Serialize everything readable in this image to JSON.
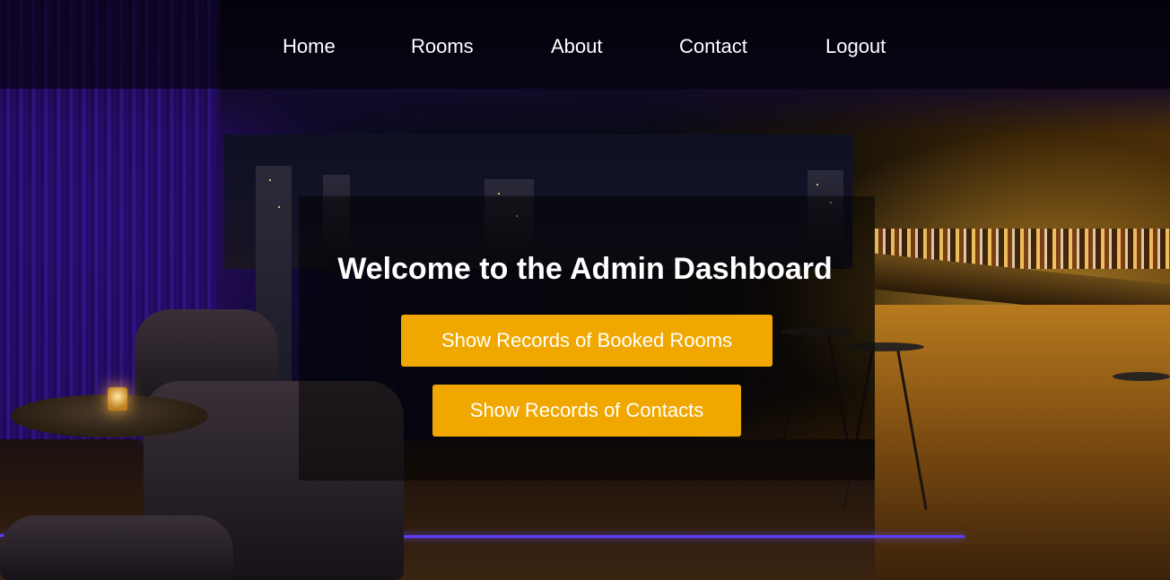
{
  "nav": {
    "items": [
      {
        "label": "Home"
      },
      {
        "label": "Rooms"
      },
      {
        "label": "About"
      },
      {
        "label": "Contact"
      },
      {
        "label": "Logout"
      }
    ]
  },
  "main": {
    "title": "Welcome to the Admin Dashboard",
    "buttons": {
      "booked_rooms": "Show Records of Booked Rooms",
      "contacts": "Show Records of Contacts"
    }
  },
  "colors": {
    "button_bg": "#f0a800",
    "button_text": "#ffffff",
    "nav_text": "#ffffff"
  }
}
